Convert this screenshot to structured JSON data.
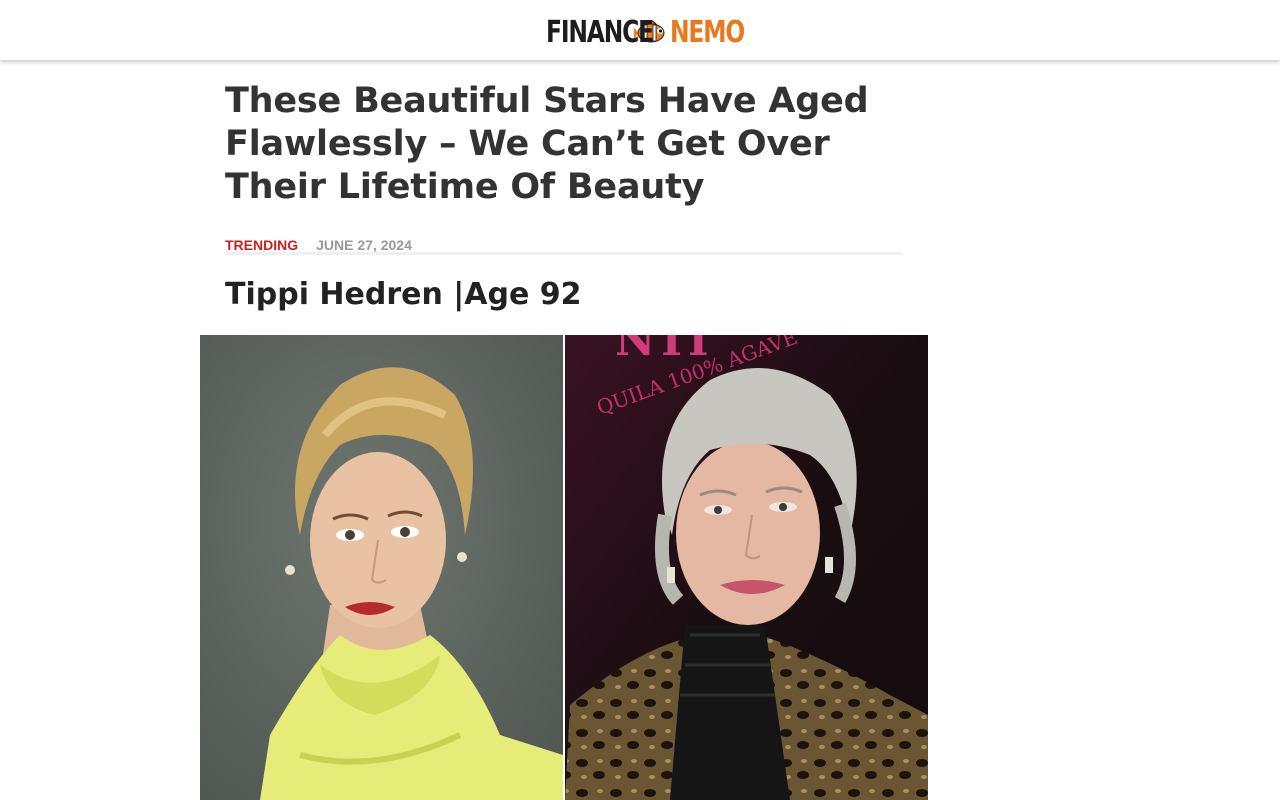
{
  "site": {
    "logo_left": "FINANCE",
    "logo_right": "NEMO",
    "logo_icon": "clownfish-icon"
  },
  "article": {
    "title": "These Beautiful Stars Have Aged Flawlessly – We Can’t Get Over Their Lifetime Of Beauty",
    "category": "TRENDING",
    "date": "JUNE 27, 2024",
    "section_heading": "Tippi Hedren |Age 92"
  },
  "image": {
    "right_backdrop_text": "QUILA 100% AGAVE"
  },
  "colors": {
    "brand_orange": "#e77a1e",
    "category_red": "#c6231e",
    "text_dark": "#333333",
    "meta_gray": "#999999"
  }
}
